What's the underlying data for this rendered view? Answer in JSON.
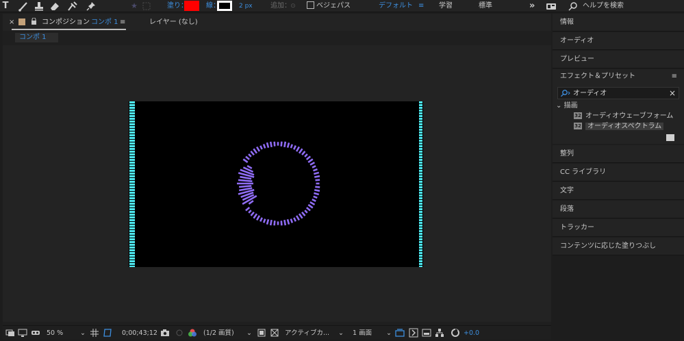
{
  "toolbar": {
    "fill_label": "塗り：",
    "stroke_label": "線：",
    "stroke_width": "2 px",
    "add_label": "追加：",
    "bezier_label": "ベジェパス",
    "workspace_default": "デフォルト",
    "workspace_learn": "学習",
    "workspace_standard": "標準",
    "overflow": "»",
    "help_search": "ヘルプを検索",
    "fill_color": "#ff0000",
    "stroke_color": "#000000",
    "accent_color": "#3d8fe0"
  },
  "comp_panel": {
    "close": "×",
    "tab_title": "コンポジション",
    "tab_comp_name": "コンポ 1",
    "menu_icon": "≡",
    "layer_tab": "レイヤー (なし)",
    "sub_tab": "コンポ 1"
  },
  "bottom_bar": {
    "zoom": "50 %",
    "timecode": "0;00;43;12",
    "resolution": "(1/2 画質)",
    "camera": "アクティブカ...",
    "views": "1 画面",
    "exposure": "+0.0"
  },
  "right_panel": {
    "info": "情報",
    "audio": "オーディオ",
    "preview": "プレビュー",
    "effects_presets": "エフェクト＆プリセット",
    "search_value": "オーディオ",
    "clear": "×",
    "category": "描画",
    "effect_1": "オーディオウェーブフォーム",
    "effect_2": "オーディオスペクトラム",
    "badge": "32",
    "align": "整列",
    "libraries": "CC ライブラリ",
    "character": "文字",
    "paragraph": "段落",
    "tracker": "トラッカー",
    "content_aware_fill": "コンテンツに応じた塗りつぶし"
  },
  "canvas": {
    "background": "#000000",
    "edge_bar_color": "#4de8f0",
    "spectrum_color": "#8f6cf5"
  }
}
